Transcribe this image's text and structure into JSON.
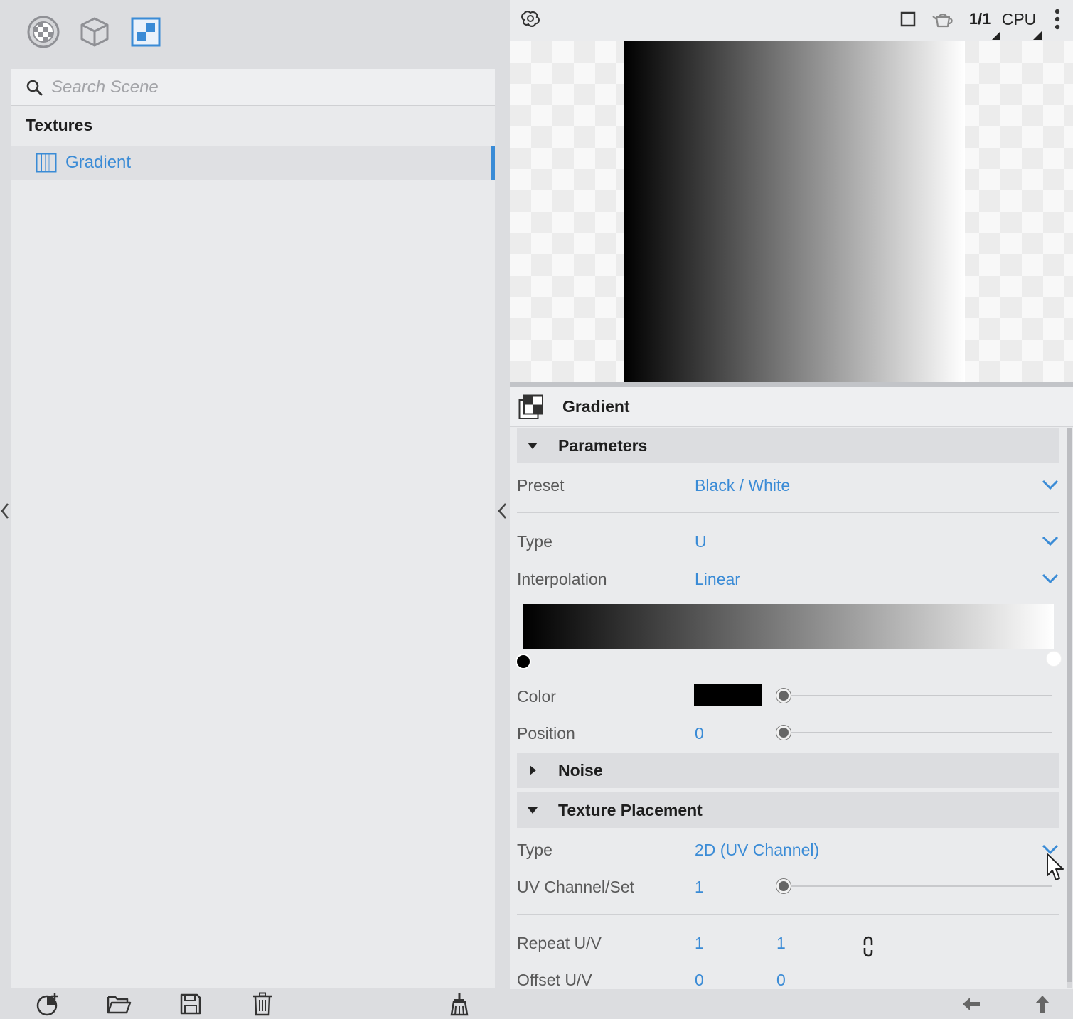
{
  "left": {
    "mode_icons": [
      "material-ball-icon",
      "cube-icon",
      "texture-icon"
    ],
    "search": {
      "placeholder": "Search Scene",
      "value": ""
    },
    "section_title": "Textures",
    "items": [
      {
        "label": "Gradient",
        "selected": true
      }
    ],
    "bottom_icons": [
      "add-icon",
      "open-folder-icon",
      "save-icon",
      "delete-icon",
      "clean-brush-icon"
    ]
  },
  "viewer": {
    "ratio": "1/1",
    "device": "CPU",
    "icons": [
      "brain-icon",
      "frame-icon",
      "teapot-icon",
      "more-icon"
    ]
  },
  "properties": {
    "title": "Gradient",
    "sections": {
      "parameters": "Parameters",
      "noise": "Noise",
      "texture_placement": "Texture Placement"
    },
    "preset": {
      "label": "Preset",
      "value": "Black / White"
    },
    "type": {
      "label": "Type",
      "value": "U"
    },
    "interpolation": {
      "label": "Interpolation",
      "value": "Linear"
    },
    "color": {
      "label": "Color",
      "value": "#000000",
      "slider": 0
    },
    "position": {
      "label": "Position",
      "value": "0",
      "slider": 0
    },
    "placement_type": {
      "label": "Type",
      "value": "2D (UV Channel)"
    },
    "uv_channel": {
      "label": "UV Channel/Set",
      "value": "1",
      "slider": 0
    },
    "repeat": {
      "label": "Repeat U/V",
      "u": "1",
      "v": "1"
    },
    "offset": {
      "label": "Offset U/V",
      "u": "0",
      "v": "0"
    }
  },
  "colors": {
    "accent": "#3a8bd6",
    "panel": "#dcdde0"
  }
}
